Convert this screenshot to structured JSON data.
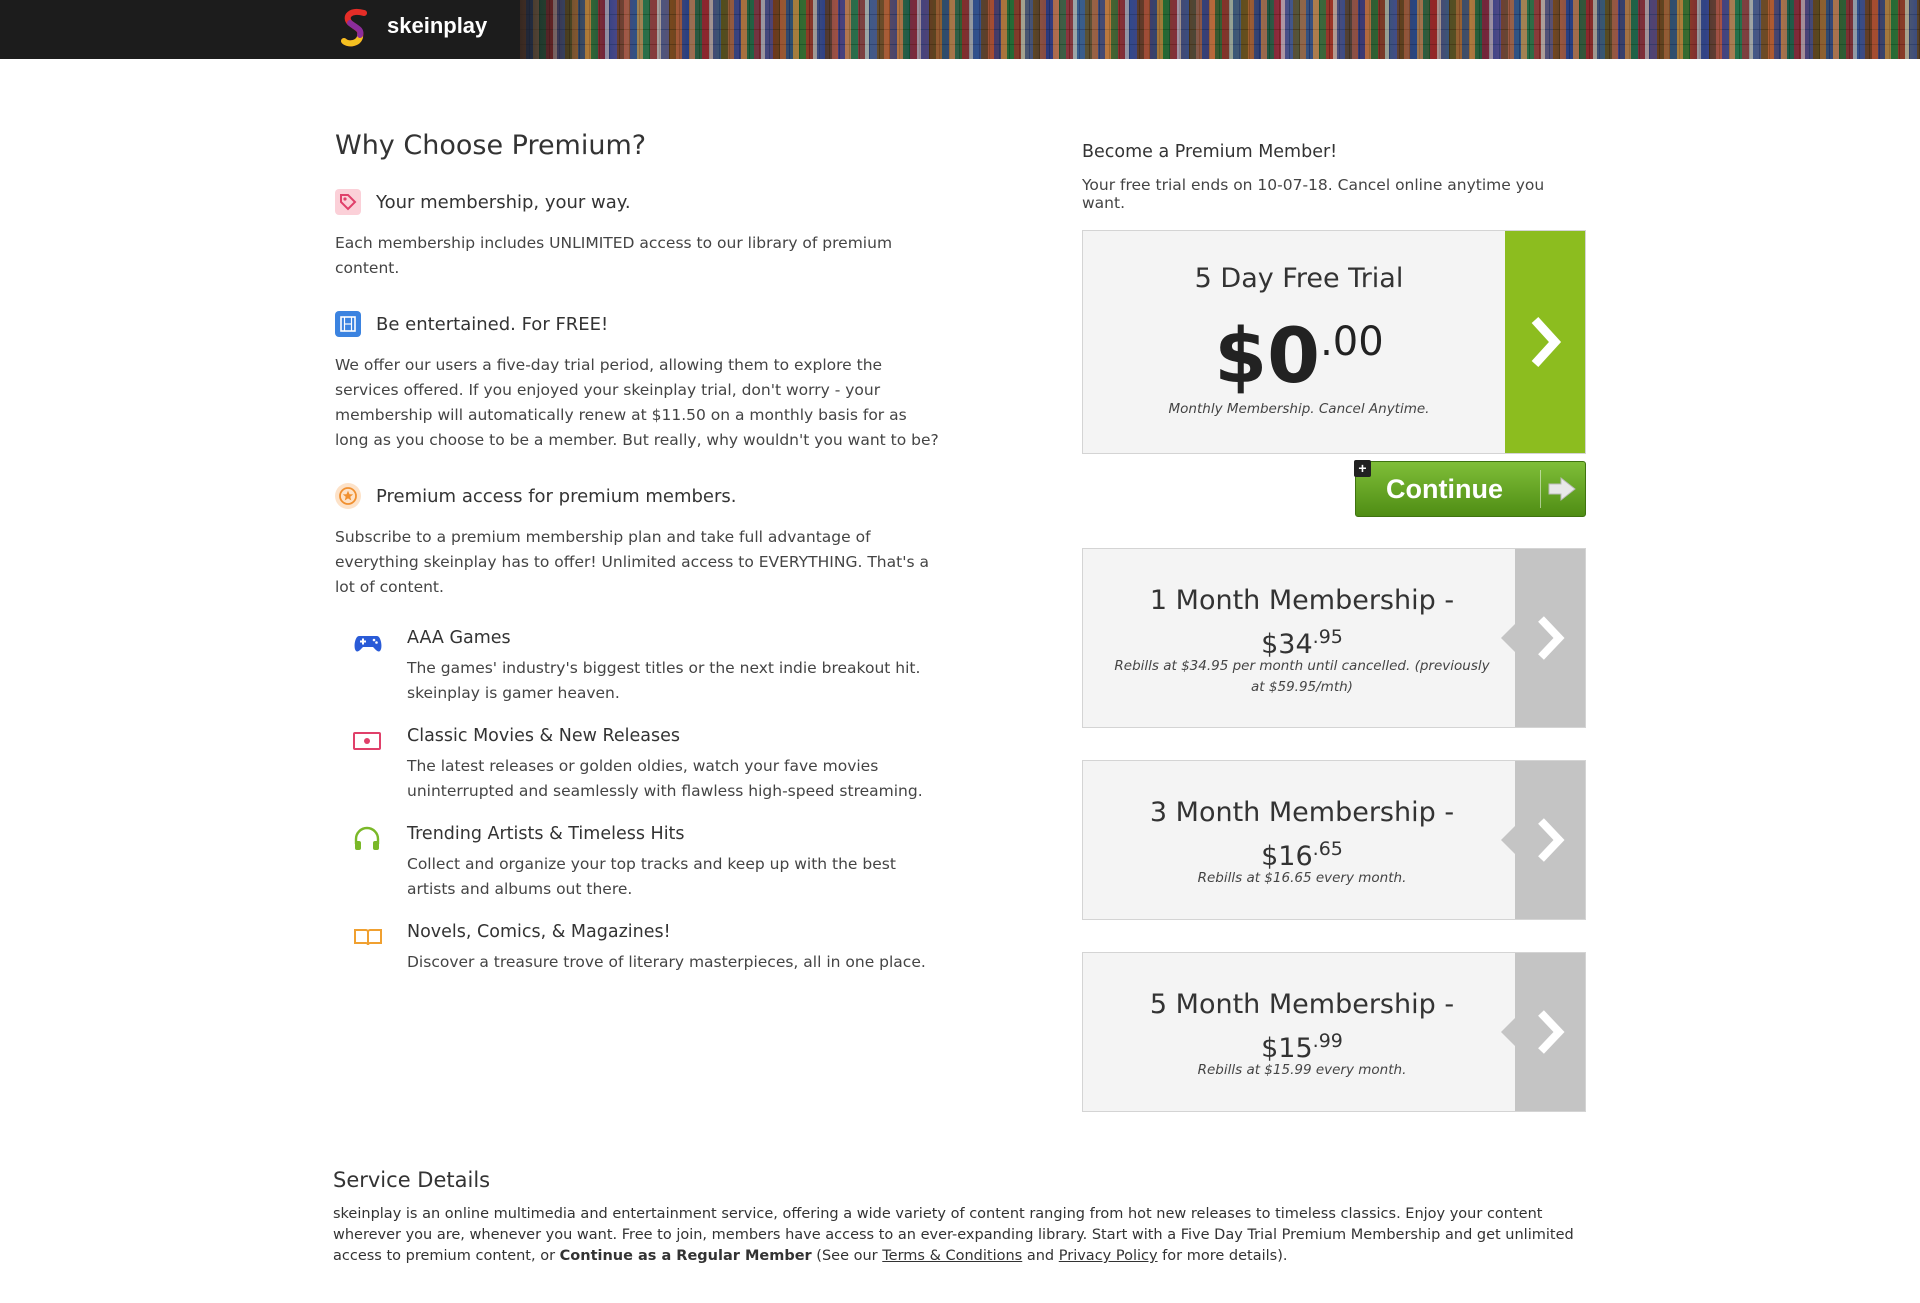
{
  "header": {
    "brand": "skeinplay"
  },
  "why": {
    "heading": "Why Choose Premium?",
    "features": [
      {
        "icon": "tag-icon",
        "title": "Your membership, your way.",
        "text": "Each membership includes UNLIMITED access to our library of premium content."
      },
      {
        "icon": "film-icon",
        "title": "Be entertained. For FREE!",
        "text": "We offer our users a five-day trial period, allowing them to explore the services offered. If you enjoyed your skeinplay trial, don't worry - your membership will automatically renew at $11.50 on a monthly basis for as long as you choose to be a member. But really, why wouldn't you want to be?"
      },
      {
        "icon": "star-icon",
        "title": "Premium access for premium members.",
        "text": "Subscribe to a premium membership plan and take full advantage of everything skeinplay has to offer! Unlimited access to EVERYTHING. That's a lot of content."
      }
    ],
    "subitems": [
      {
        "icon": "gamepad-icon",
        "color": "#2a5bd7",
        "title": "AAA Games",
        "text": "The games' industry's biggest titles or the next indie breakout hit. skeinplay is gamer heaven."
      },
      {
        "icon": "movie-icon",
        "color": "#e0406a",
        "title": "Classic Movies & New Releases",
        "text": "The latest releases or golden oldies, watch your fave movies uninterrupted and seamlessly with flawless high-speed streaming."
      },
      {
        "icon": "headphones-icon",
        "color": "#7ab828",
        "title": "Trending Artists & Timeless Hits",
        "text": "Collect and organize your top tracks and keep up with the best artists and albums out there."
      },
      {
        "icon": "book-icon",
        "color": "#f0a030",
        "title": "Novels, Comics, & Magazines!",
        "text": "Discover a treasure trove of literary masterpieces, all in one place."
      }
    ]
  },
  "membership": {
    "heading": "Become a Premium Member!",
    "subheading": "Your free trial ends on 10-07-18. Cancel online anytime you want.",
    "trial": {
      "title": "5 Day Free Trial",
      "dollars": "$0",
      "cents": ".00",
      "note": "Monthly Membership. Cancel Anytime."
    },
    "continue_label": "Continue",
    "plans": [
      {
        "title": "1 Month Membership -",
        "dollars": "$34",
        "cents": ".95",
        "note": "Rebills at $34.95 per month until cancelled. (previously at $59.95/mth)"
      },
      {
        "title": "3 Month Membership -",
        "dollars": "$16",
        "cents": ".65",
        "note": "Rebills at $16.65 every month."
      },
      {
        "title": "5 Month Membership -",
        "dollars": "$15",
        "cents": ".99",
        "note": "Rebills at $15.99 every month."
      }
    ]
  },
  "service": {
    "heading": "Service Details",
    "text1": "skeinplay is an online multimedia and entertainment service, offering a wide variety of content ranging from hot new releases to timeless classics. Enjoy your content wherever you are, whenever you want. Free to join, members have access to an ever-expanding library. Start with a Five Day Trial Premium Membership and get unlimited access to premium content, or ",
    "bold": "Continue as a Regular Member",
    "text2": " (See our ",
    "terms": "Terms & Conditions",
    "and": " and ",
    "privacy": "Privacy Policy",
    "text3": " for more details)."
  },
  "colors": {
    "accent_green": "#8cbd1f",
    "button_green": "#5a9a1c",
    "arrow_gray": "#c4c4c4"
  }
}
